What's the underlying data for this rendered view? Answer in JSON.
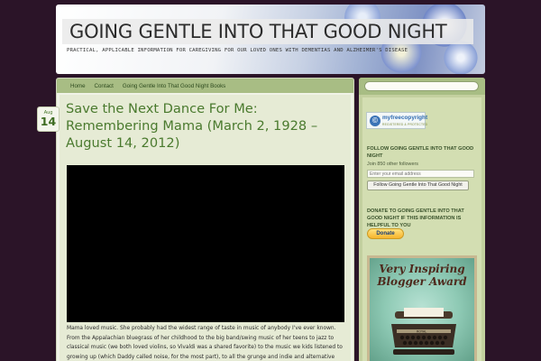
{
  "site": {
    "title": "GOING GENTLE INTO THAT GOOD NIGHT",
    "tagline": "PRACTICAL, APPLICABLE INFORMATION FOR CAREGIVING FOR OUR LOVED ONES WITH DEMENTIAS AND ALZHEIMER'S DISEASE"
  },
  "nav": {
    "items": [
      {
        "label": "Home"
      },
      {
        "label": "Contact"
      },
      {
        "label": "Going Gentle Into That Good Night Books"
      }
    ]
  },
  "post": {
    "date_month": "Aug",
    "date_day": "14",
    "title": "Save the Next Dance For Me: Remembering Mama (March 2, 1928 – August 14, 2012)",
    "body": "Mama loved music. She probably had the widest range of taste in music of anybody I've ever known. From the Appalachian bluegrass of her childhood to the big band/swing music of her teens to jazz to classical music (we both loved violins, so Vivaldi was a shared favorite) to the music we kids listened to growing up (which Daddy called noise, for the most part), to all the grunge and indie and alternative music I introduced to her. It was a rare time when she said, \"I"
  },
  "sidebar": {
    "search_placeholder": "",
    "copyright_brand": "myfreecopyright",
    "copyright_sub": "REGISTERED & PROTECTED",
    "follow_title": "FOLLOW GOING GENTLE INTO THAT GOOD NIGHT",
    "followers_text": "Join 850 other followers",
    "email_placeholder": "Enter your email address",
    "follow_button": "Follow Going Gentle Into That Good Night",
    "donate_title": "DONATE TO GOING GENTLE INTO THAT GOOD NIGHT IF THIS INFORMATION IS HELPFUL TO YOU",
    "donate_button": "Donate",
    "award_text": "Very Inspiring Blogger Award"
  },
  "colors": {
    "background": "#2b1428",
    "nav": "#a8bd84",
    "title_green": "#4a7a2e",
    "sidebar": "#c3d09f"
  },
  "icons": {
    "copyright_logo": "copyright-icon",
    "typewriter": "typewriter-icon"
  }
}
